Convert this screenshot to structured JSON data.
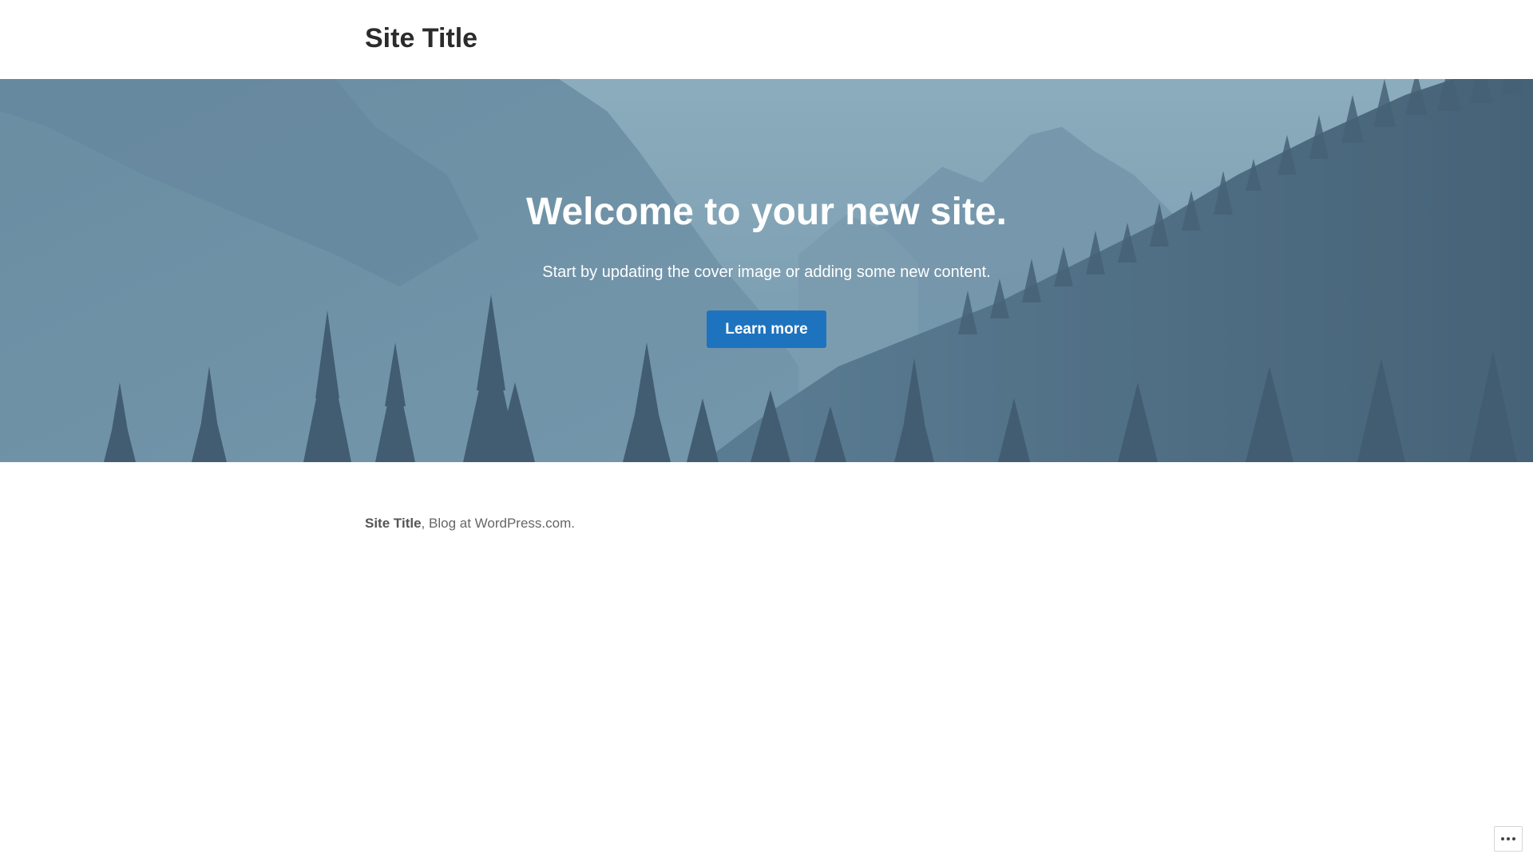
{
  "header": {
    "site_title": "Site Title"
  },
  "cover": {
    "heading": "Welcome to your new site.",
    "text": "Start by updating the cover image or adding some new content.",
    "button_label": "Learn more"
  },
  "footer": {
    "site_title": "Site Title",
    "separator": ",",
    "credit": "Blog at WordPress.com."
  },
  "actionbar": {
    "icon": "ellipsis-icon"
  },
  "colors": {
    "button": "#1e73be",
    "cover_overlay": "#6f93a8",
    "title_text": "#2b2b2b"
  }
}
